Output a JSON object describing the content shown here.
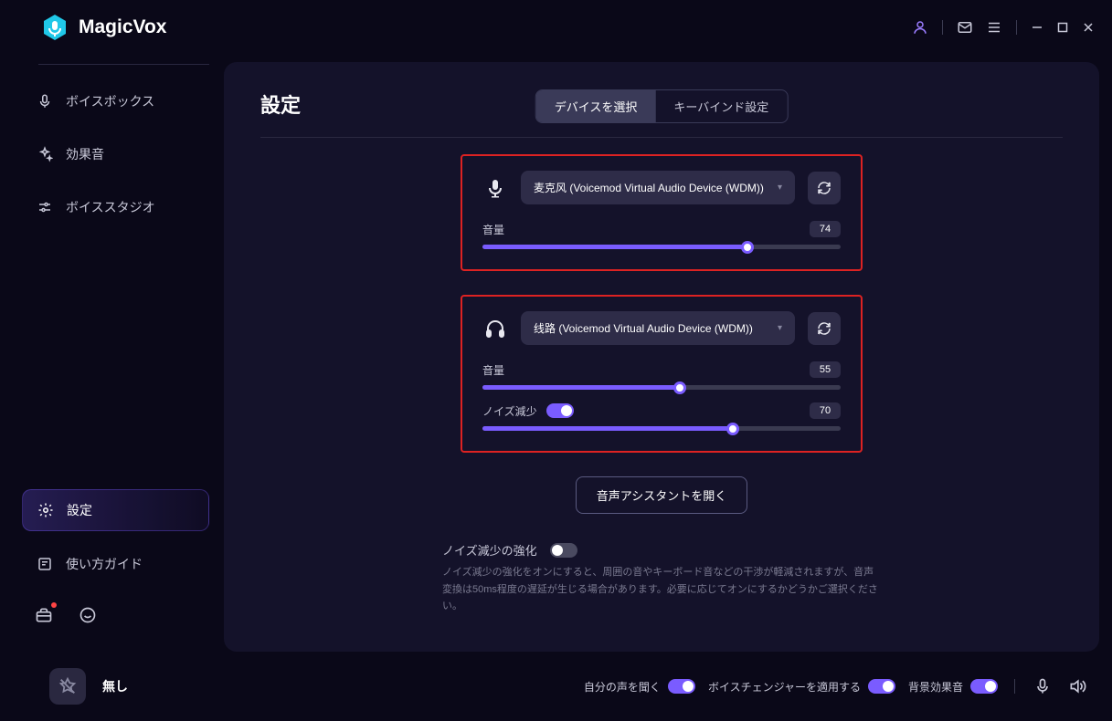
{
  "app": {
    "name": "MagicVox"
  },
  "sidebar": {
    "items": [
      {
        "label": "ボイスボックス"
      },
      {
        "label": "効果音"
      },
      {
        "label": "ボイススタジオ"
      },
      {
        "label": "設定"
      },
      {
        "label": "使い方ガイド"
      }
    ]
  },
  "main": {
    "title": "設定",
    "tabs": {
      "device": "デバイスを選択",
      "keybind": "キーバインド設定"
    },
    "mic": {
      "selected": "麦克风 (Voicemod Virtual Audio Device (WDM))",
      "volume_label": "音量",
      "volume_value": "74",
      "volume_pct": 74
    },
    "out": {
      "selected": "线路 (Voicemod Virtual Audio Device (WDM))",
      "volume_label": "音量",
      "volume_value": "55",
      "volume_pct": 55,
      "noise_label": "ノイズ減少",
      "noise_value": "70",
      "noise_pct": 70
    },
    "assist_button": "音声アシスタントを開く",
    "enhance": {
      "title": "ノイズ減少の強化",
      "desc": "ノイズ減少の強化をオンにすると、周囲の音やキーボード音などの干渉が軽減されますが、音声変換は50ms程度の遅延が生じる場合があります。必要に応じてオンにするかどうかご選択ください。"
    }
  },
  "bottombar": {
    "preset": "無し",
    "hear_self": "自分の声を聞く",
    "apply_changer": "ボイスチェンジャーを適用する",
    "bg_sound": "背景効果音"
  }
}
